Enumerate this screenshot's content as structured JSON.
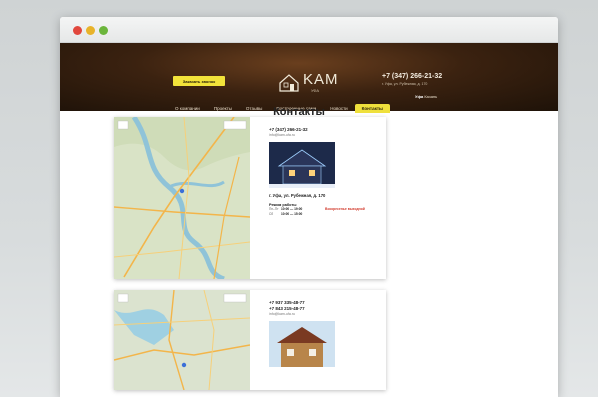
{
  "window": {
    "controls": [
      "close",
      "minimize",
      "maximize"
    ]
  },
  "header": {
    "callback_button": "Заказать звонок",
    "logo_text": "KAM",
    "logo_sub": "УФА",
    "phone": "+7 (347) 266-21-32",
    "address": "г. Уфа, ул. Рубежная, д. 170",
    "city_label": "Уфа",
    "city_switch": "Казань"
  },
  "nav": {
    "items": [
      {
        "label": "О компании"
      },
      {
        "label": "Проекты"
      },
      {
        "label": "Отзывы"
      },
      {
        "label": "Построенные сами"
      },
      {
        "label": "Новости"
      },
      {
        "label": "Контакты",
        "active": true
      }
    ]
  },
  "page": {
    "title": "Контакты"
  },
  "contacts": [
    {
      "phone": "+7 (347) 266-21-32",
      "email": "info@kam-ufa.ru",
      "address": "г. Уфа, ул. Рубежная, д. 170",
      "hours_title": "Режим работы",
      "hours": [
        {
          "days": "Пн–Пт",
          "time": "10:00 — 19:00"
        },
        {
          "days": "Сб",
          "time": "10:00 — 15:00"
        }
      ],
      "holiday": "Воскресенье выходной"
    },
    {
      "phones": [
        "+7 937 335-48-77",
        "+7 843 215-48-77"
      ],
      "email": "info@kam-ufa.ru"
    }
  ],
  "colors": {
    "accent": "#efe03c",
    "header_bg": "#3b2210",
    "holiday": "#d23a2c"
  }
}
